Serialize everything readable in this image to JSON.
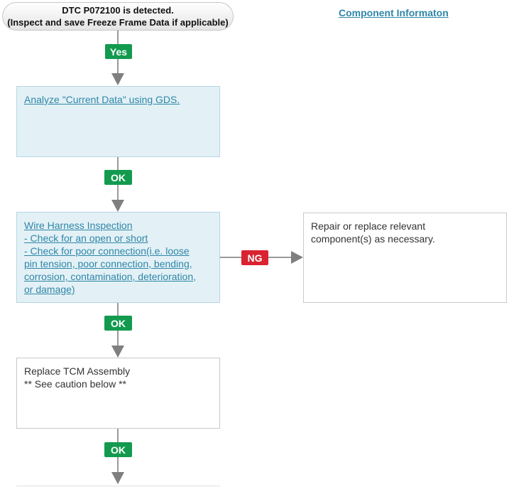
{
  "start": {
    "line1": "DTC P072100 is detected.",
    "line2": "(Inspect and save Freeze Frame Data if applicable)"
  },
  "component_link": "Component Informaton",
  "badges": {
    "yes": "Yes",
    "ok1": "OK",
    "ok2": "OK",
    "ok3": "OK",
    "ng": "NG"
  },
  "step1": {
    "text": "Analyze \"Current Data\" using GDS."
  },
  "step2": {
    "lines": [
      "Wire Harness Inspection",
      "- Check for an open or short",
      "- Check for poor connection(i.e. loose",
      "pin tension, poor connection, bending,",
      "corrosion, contamination, deterioration,",
      "or damage)"
    ]
  },
  "ng_box": {
    "lines": [
      "Repair or replace relevant",
      "component(s) as necessary."
    ]
  },
  "step3": {
    "lines": [
      "Replace TCM Assembly",
      "** See caution below **"
    ]
  },
  "colors": {
    "ok_green": "#139a4f",
    "ng_red": "#d92331",
    "link_blue": "#2f86a8",
    "box_blue_bg": "#e3f1f6"
  }
}
